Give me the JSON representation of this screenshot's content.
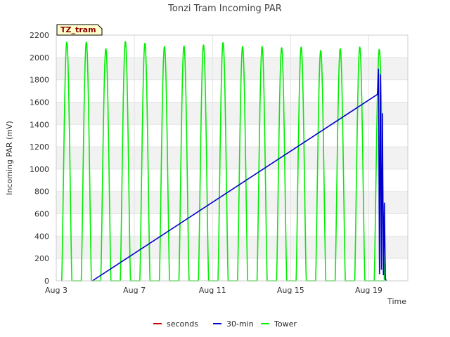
{
  "chart_data": {
    "type": "line",
    "title": "Tonzi Tram Incoming PAR",
    "xlabel": "Time",
    "ylabel": "Incoming PAR (mV)",
    "badge": "TZ_tram",
    "xlim": [
      3,
      21
    ],
    "ylim": [
      0,
      2200
    ],
    "x_unit": "day of August",
    "x_ticks": [
      {
        "value": 3,
        "label": "Aug 3"
      },
      {
        "value": 7,
        "label": "Aug 7"
      },
      {
        "value": 11,
        "label": "Aug 11"
      },
      {
        "value": 15,
        "label": "Aug 15"
      },
      {
        "value": 19,
        "label": "Aug 19"
      }
    ],
    "y_ticks": [
      0,
      200,
      400,
      600,
      800,
      1000,
      1200,
      1400,
      1600,
      1800,
      2000,
      2200
    ],
    "grid": true,
    "grid_bands": "alternating light gray",
    "legend_position": "bottom-center",
    "colors": {
      "seconds": "#d00000",
      "30-min": "#0000cc",
      "Tower": "#00ee00"
    },
    "series": [
      {
        "name": "seconds",
        "points": []
      },
      {
        "name": "30-min",
        "points": [
          [
            4.85,
            0
          ],
          [
            19.45,
            1670
          ],
          [
            19.5,
            1900
          ],
          [
            19.55,
            60
          ],
          [
            19.6,
            1850
          ],
          [
            19.65,
            100
          ],
          [
            19.7,
            1500
          ],
          [
            19.75,
            50
          ],
          [
            19.8,
            700
          ],
          [
            19.85,
            20
          ],
          [
            19.9,
            0
          ]
        ]
      },
      {
        "name": "Tower",
        "daily_start": 3.3,
        "daily_end": 19.3,
        "peaks": [
          2140,
          2140,
          2080,
          2145,
          2130,
          2100,
          2105,
          2115,
          2135,
          2100,
          2100,
          2090,
          2095,
          2065,
          2080,
          2095,
          2075
        ]
      }
    ]
  }
}
